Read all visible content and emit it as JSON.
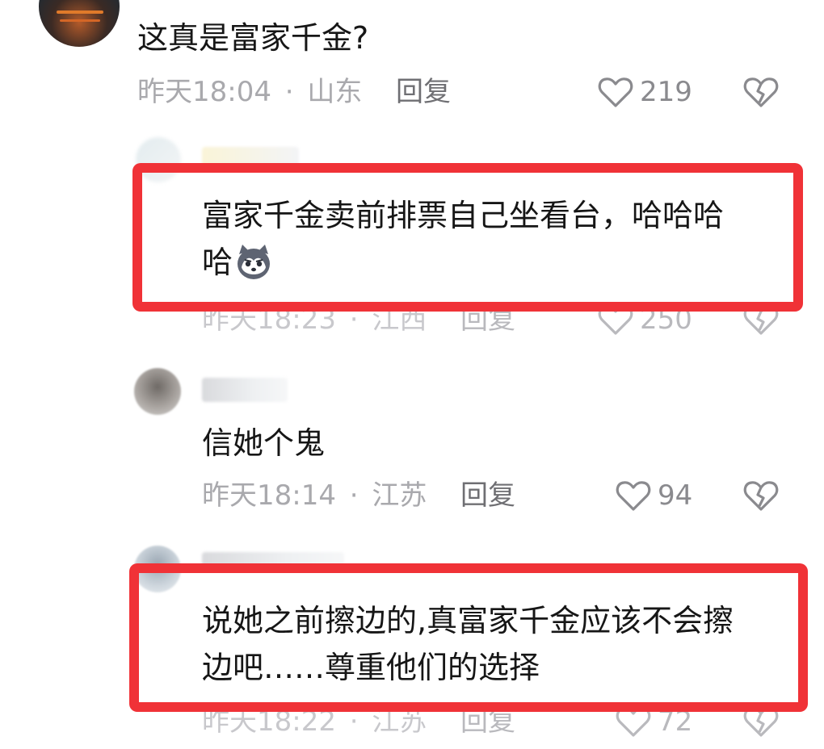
{
  "comments": [
    {
      "text": "这真是富家千金?",
      "time": "昨天18:04",
      "sep": "·",
      "location": "山东",
      "reply": "回复",
      "likes": "219"
    },
    {
      "text_line1": "富家千金卖前排票自己坐看台，哈哈哈",
      "text_line2": "哈",
      "time": "昨天18:23",
      "sep": "·",
      "location": "江西",
      "reply": "回复",
      "likes": "250"
    },
    {
      "text": "信她个鬼",
      "time": "昨天18:14",
      "sep": "·",
      "location": "江苏",
      "reply": "回复",
      "likes": "94"
    },
    {
      "text_line1": "说她之前擦边的,真富家千金应该不会擦",
      "text_line2": "边吧……尊重他们的选择",
      "time": "昨天18:22",
      "sep": "·",
      "location": "江苏",
      "reply": "回复",
      "likes": "72"
    }
  ],
  "icons": {
    "like": "heart-outline-icon",
    "dislike": "broken-heart-icon",
    "emoji": "husky-dog-emoji"
  },
  "colors": {
    "highlight_border": "#f03237",
    "meta_text": "#a9a9ad",
    "icon_gray": "#8a8a8e"
  }
}
